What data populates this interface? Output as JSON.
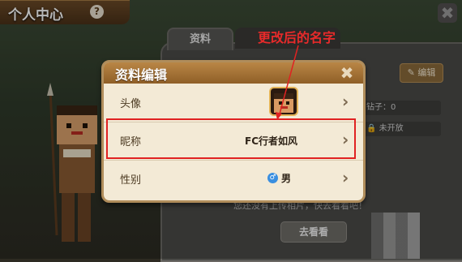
{
  "header": {
    "title": "个人中心",
    "help_icon": "?",
    "close_icon": "✖"
  },
  "background_panel": {
    "tab_active": "资料",
    "edit_button": "编辑",
    "row_coins": "钻子：0",
    "row_lock": "未开放",
    "upload_hint": "您还没有上传相片，快去看看吧！",
    "goto_button": "去看看"
  },
  "modal": {
    "title": "资料编辑",
    "close_icon": "✖",
    "rows": [
      {
        "label": "头像",
        "arrow": "›"
      },
      {
        "label": "昵称",
        "value": "FC行者如风",
        "arrow": "›"
      },
      {
        "label": "性别",
        "value": "男",
        "gender_icon": "♂",
        "arrow": "›"
      }
    ]
  },
  "annotation": {
    "text": "更改后的名字",
    "color": "#e82a2a"
  }
}
